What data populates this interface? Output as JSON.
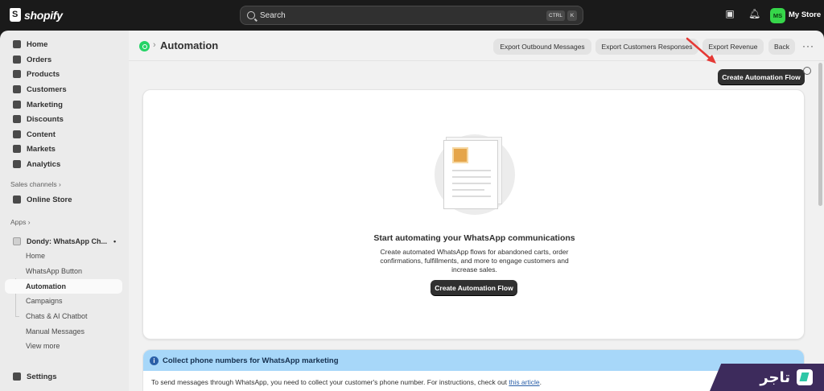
{
  "topbar": {
    "brand": "shopify",
    "search_label": "Search",
    "shortcut_ctrl": "CTRL",
    "shortcut_k": "K",
    "store_initials": "MS",
    "store_name": "My Store",
    "store_color": "#36d64a"
  },
  "sidebar": {
    "main_nav": [
      {
        "label": "Home",
        "icon": "home-icon"
      },
      {
        "label": "Orders",
        "icon": "orders-icon"
      },
      {
        "label": "Products",
        "icon": "tag-icon"
      },
      {
        "label": "Customers",
        "icon": "person-icon"
      },
      {
        "label": "Marketing",
        "icon": "target-icon"
      },
      {
        "label": "Discounts",
        "icon": "discount-icon"
      },
      {
        "label": "Content",
        "icon": "content-icon"
      },
      {
        "label": "Markets",
        "icon": "globe-icon"
      },
      {
        "label": "Analytics",
        "icon": "chart-icon"
      }
    ],
    "sales_channels_label": "Sales channels",
    "online_store": "Online Store",
    "apps_label": "Apps",
    "app_name": "Dondy: WhatsApp Ch...",
    "app_sub_items": [
      "Home",
      "WhatsApp Button",
      "Automation",
      "Campaigns",
      "Chats & AI Chatbot",
      "Manual Messages",
      "View more"
    ],
    "active_sub_item": "Automation",
    "settings": "Settings"
  },
  "header": {
    "title": "Automation",
    "buttons": [
      "Export Outbound Messages",
      "Export Customers Responses",
      "Export Revenue",
      "Back"
    ],
    "more": "•••",
    "primary_action": "Create Automation Flow"
  },
  "empty_state": {
    "title": "Start automating your WhatsApp communications",
    "description": "Create automated WhatsApp flows for abandoned carts, order confirmations, fulfillments, and more to engage customers and increase sales.",
    "button": "Create Automation Flow"
  },
  "banner": {
    "title": "Collect phone numbers for WhatsApp marketing",
    "body": "To send messages through WhatsApp, you need to collect your customer's phone number. For instructions, check out ",
    "link": "this article",
    "tail": "."
  },
  "watermark": {
    "text": "تاجر"
  },
  "colors": {
    "accent_dark": "#303030",
    "banner_bg": "#a7d7f9",
    "whatsapp": "#25d366",
    "arrow": "#e53935"
  }
}
